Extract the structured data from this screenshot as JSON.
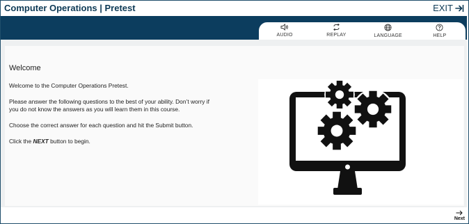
{
  "header": {
    "title": "Computer Operations | Pretest",
    "exit_label": "EXIT"
  },
  "toolbar": {
    "items": [
      {
        "label": "AUDIO",
        "icon": "speaker-icon"
      },
      {
        "label": "REPLAY",
        "icon": "replay-icon"
      },
      {
        "label": "LANGUAGE",
        "icon": "globe-icon"
      },
      {
        "label": "HELP",
        "icon": "help-icon"
      }
    ]
  },
  "content": {
    "heading": "Welcome",
    "intro": "Welcome to the Computer Operations Pretest.",
    "instructions": "Please answer the following questions to the best of your ability. Don’t worry if you do not know the answers as you will learn them in this course.",
    "submit_note": "Choose the correct answer for each question and hit the Submit button.",
    "begin_prefix": "Click the ",
    "begin_emphasis": "NEXT",
    "begin_suffix": " button to begin."
  },
  "footer": {
    "next_label": "Next"
  },
  "colors": {
    "navy": "#0c3d5e",
    "title_text": "#0e3a56",
    "panel_bg": "#fafafa",
    "illustration": "#111111"
  }
}
